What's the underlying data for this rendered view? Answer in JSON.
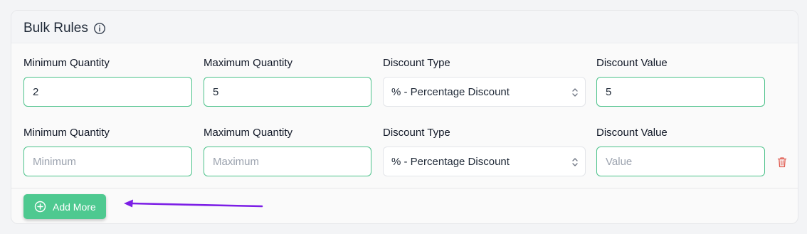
{
  "card": {
    "title": "Bulk Rules",
    "info_icon": "info-circle-icon"
  },
  "rules": [
    {
      "min_label": "Minimum Quantity",
      "min_value": "2",
      "min_placeholder": "Minimum",
      "max_label": "Maximum Quantity",
      "max_value": "5",
      "max_placeholder": "Maximum",
      "type_label": "Discount Type",
      "type_value": "% - Percentage Discount",
      "value_label": "Discount Value",
      "value_value": "5",
      "value_placeholder": "Value"
    },
    {
      "min_label": "Minimum Quantity",
      "min_value": "",
      "min_placeholder": "Minimum",
      "max_label": "Maximum Quantity",
      "max_value": "",
      "max_placeholder": "Maximum",
      "type_label": "Discount Type",
      "type_value": "% - Percentage Discount",
      "value_label": "Discount Value",
      "value_value": "",
      "value_placeholder": "Value",
      "delete_icon": "trash-icon"
    }
  ],
  "add_more": {
    "label": "Add More",
    "icon": "plus-circle-icon"
  },
  "annotation": {
    "type": "arrow-pointing-left",
    "color": "#7c1ee6"
  },
  "colors": {
    "accent": "#4ec990",
    "input_border": "#4cc28a",
    "delete": "#e05a4f"
  }
}
